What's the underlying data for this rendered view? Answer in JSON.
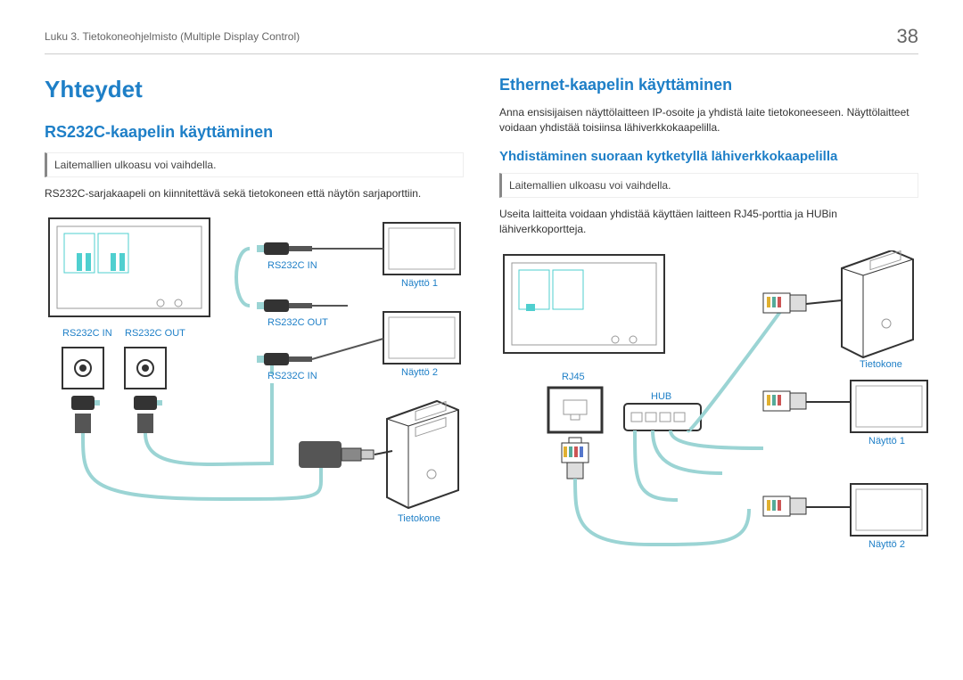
{
  "header": {
    "breadcrumb": "Luku 3. Tietokoneohjelmisto (Multiple Display Control)",
    "pagenum": "38"
  },
  "left": {
    "h1": "Yhteydet",
    "h2": "RS232C-kaapelin käyttäminen",
    "note": "Laitemallien ulkoasu voi vaihdella.",
    "body": "RS232C-sarjakaapeli on kiinnitettävä sekä tietokoneen että näytön sarjaporttiin.",
    "labels": {
      "rs232c_in": "RS232C IN",
      "rs232c_out": "RS232C OUT",
      "monitor1": "Näyttö 1",
      "monitor2": "Näyttö 2",
      "computer": "Tietokone"
    }
  },
  "right": {
    "h2": "Ethernet-kaapelin käyttäminen",
    "intro": "Anna ensisijaisen näyttölaitteen IP-osoite ja yhdistä laite tietokoneeseen. Näyttölaitteet voidaan yhdistää toisiinsa lähiverkkokaapelilla.",
    "h3": "Yhdistäminen suoraan kytketyllä lähiverkkokaapelilla",
    "note": "Laitemallien ulkoasu voi vaihdella.",
    "body": "Useita laitteita voidaan yhdistää käyttäen laitteen RJ45-porttia ja HUBin lähiverkkoportteja.",
    "labels": {
      "rj45": "RJ45",
      "hub": "HUB",
      "computer": "Tietokone",
      "monitor1": "Näyttö 1",
      "monitor2": "Näyttö 2"
    }
  }
}
